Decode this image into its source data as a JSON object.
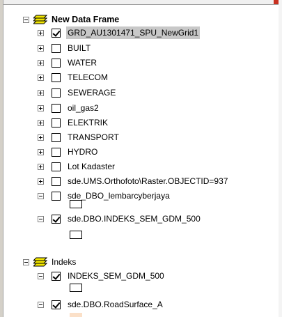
{
  "toc": {
    "frames": [
      {
        "name": "New Data Frame",
        "layers": [
          {
            "label": "GRD_AU1301471_SPU_NewGrid1",
            "checked": true,
            "expanded": false,
            "selected": true
          },
          {
            "label": "BUILT",
            "checked": false,
            "expanded": false
          },
          {
            "label": "WATER",
            "checked": false,
            "expanded": false
          },
          {
            "label": "TELECOM",
            "checked": false,
            "expanded": false
          },
          {
            "label": "SEWERAGE",
            "checked": false,
            "expanded": false
          },
          {
            "label": "oil_gas2",
            "checked": false,
            "expanded": false
          },
          {
            "label": "ELEKTRIK",
            "checked": false,
            "expanded": false
          },
          {
            "label": "TRANSPORT",
            "checked": false,
            "expanded": false
          },
          {
            "label": "HYDRO",
            "checked": false,
            "expanded": false
          },
          {
            "label": "Lot Kadaster",
            "checked": false,
            "expanded": false
          },
          {
            "label": "sde.UMS.Orthofoto\\Raster.OBJECTID=937",
            "checked": false,
            "expanded": false
          },
          {
            "label": "sde_DBO_lembarcyberjaya",
            "checked": false,
            "expanded": true
          },
          {
            "label": "sde.DBO.INDEKS_SEM_GDM_500",
            "checked": true,
            "expanded": true
          }
        ]
      },
      {
        "name": "Indeks",
        "layers": [
          {
            "label": "INDEKS_SEM_GDM_500",
            "checked": true,
            "expanded": true
          },
          {
            "label": "sde.DBO.RoadSurface_A",
            "checked": true,
            "expanded": true
          }
        ]
      }
    ]
  },
  "icons": {
    "data_frame": "data-frame-icon",
    "expand": "expand-plus-icon",
    "collapse": "collapse-minus-icon"
  },
  "colors": {
    "frame_icon_yellow": "#f2e600",
    "selection": "#c8c8c8",
    "symbol_peach": "#fbe0c8"
  }
}
